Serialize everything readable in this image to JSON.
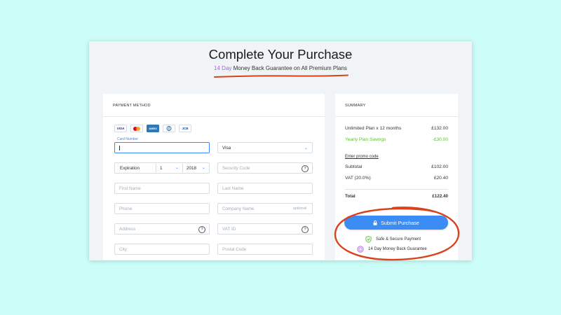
{
  "page": {
    "title": "Complete Your Purchase",
    "subtitle_accent": "14 Day",
    "subtitle_rest": " Money Back Guarantee on All Premium Plans"
  },
  "payment": {
    "section_title": "PAYMENT METHOD",
    "card_brands": [
      "VISA",
      "mastercard",
      "AMEX",
      "Diners",
      "JCB"
    ],
    "card_number_label": "Card Number",
    "card_type_value": "Visa",
    "expiration_label": "Expiration",
    "exp_month": "1",
    "exp_year": "2018",
    "security_code_placeholder": "Security Code",
    "first_name_placeholder": "First Name",
    "last_name_placeholder": "Last Name",
    "phone_placeholder": "Phone",
    "company_placeholder": "Company Name",
    "company_optional": "optional",
    "address_placeholder": "Address",
    "vat_placeholder": "VAT ID",
    "city_placeholder": "City",
    "postal_placeholder": "Postal Code",
    "help_icon_text": "?"
  },
  "summary": {
    "section_title": "SUMMARY",
    "plan_label": "Unlimited Plan x 12 months",
    "plan_price": "£132.00",
    "savings_label": "Yearly Plan Savings",
    "savings_value": "-£30.00",
    "promo_label": "Enter promo code",
    "subtotal_label": "Subtotal",
    "subtotal_value": "£102.00",
    "vat_label": "VAT (20.0%)",
    "vat_value": "£20.40",
    "total_label": "Total",
    "total_value": "£122.40",
    "submit_label": "Submit Purchase",
    "secure_text": "Safe & Secure Payment",
    "guarantee_text": "14 Day Money Back Guarantee"
  },
  "colors": {
    "background": "#ccfdf9",
    "accent_blue": "#3b8cf5",
    "annotation_red": "#d9421c",
    "savings_green": "#5fbc3a",
    "accent_purple": "#a960e8"
  }
}
